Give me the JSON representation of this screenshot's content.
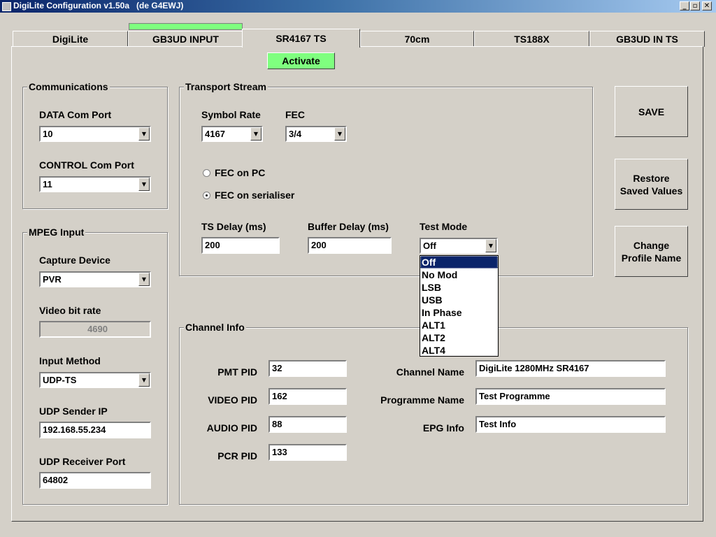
{
  "window": {
    "title": "DigiLite Configuration v1.50a   (de G4EWJ)",
    "minimize": "_",
    "restore": "▫",
    "close": "✕"
  },
  "tabs": [
    {
      "label": "DigiLite"
    },
    {
      "label": "GB3UD INPUT"
    },
    {
      "label": "SR4167 TS",
      "active": true
    },
    {
      "label": "70cm"
    },
    {
      "label": "TS188X"
    },
    {
      "label": "GB3UD IN TS"
    }
  ],
  "activate_label": "Activate",
  "colors": {
    "activate": "#7fff7f",
    "titlebar_start": "#0a246a",
    "selection": "#0a246a"
  },
  "communications": {
    "legend": "Communications",
    "data_port_label": "DATA Com Port",
    "data_port_value": "10",
    "control_port_label": "CONTROL Com Port",
    "control_port_value": "11"
  },
  "mpeg": {
    "legend": "MPEG Input",
    "capture_label": "Capture Device",
    "capture_value": "PVR",
    "bitrate_label": "Video bit rate",
    "bitrate_value": "4690",
    "input_method_label": "Input Method",
    "input_method_value": "UDP-TS",
    "sender_ip_label": "UDP Sender IP",
    "sender_ip_value": "192.168.55.234",
    "receiver_port_label": "UDP Receiver Port",
    "receiver_port_value": "64802"
  },
  "transport": {
    "legend": "Transport Stream",
    "symbol_rate_label": "Symbol Rate",
    "symbol_rate_value": "4167",
    "fec_label": "FEC",
    "fec_value": "3/4",
    "fec_pc_label": "FEC on PC",
    "fec_serialiser_label": "FEC on serialiser",
    "fec_selected": "serialiser",
    "ts_delay_label": "TS Delay (ms)",
    "ts_delay_value": "200",
    "buffer_delay_label": "Buffer Delay (ms)",
    "buffer_delay_value": "200",
    "test_mode_label": "Test Mode",
    "test_mode_value": "Off",
    "test_mode_options": [
      "Off",
      "No Mod",
      "LSB",
      "USB",
      "In Phase",
      "ALT1",
      "ALT2",
      "ALT4"
    ]
  },
  "buttons": {
    "save": "SAVE",
    "restore_l1": "Restore",
    "restore_l2": "Saved Values",
    "change_l1": "Change",
    "change_l2": "Profile Name"
  },
  "channel": {
    "legend": "Channel Info",
    "pmt_label": "PMT PID",
    "pmt_value": "32",
    "video_label": "VIDEO PID",
    "video_value": "162",
    "audio_label": "AUDIO PID",
    "audio_value": "88",
    "pcr_label": "PCR PID",
    "pcr_value": "133",
    "name_label": "Channel Name",
    "name_value": "DigiLite 1280MHz SR4167",
    "programme_label": "Programme Name",
    "programme_value": "Test Programme",
    "epg_label": "EPG Info",
    "epg_value": "Test Info"
  }
}
